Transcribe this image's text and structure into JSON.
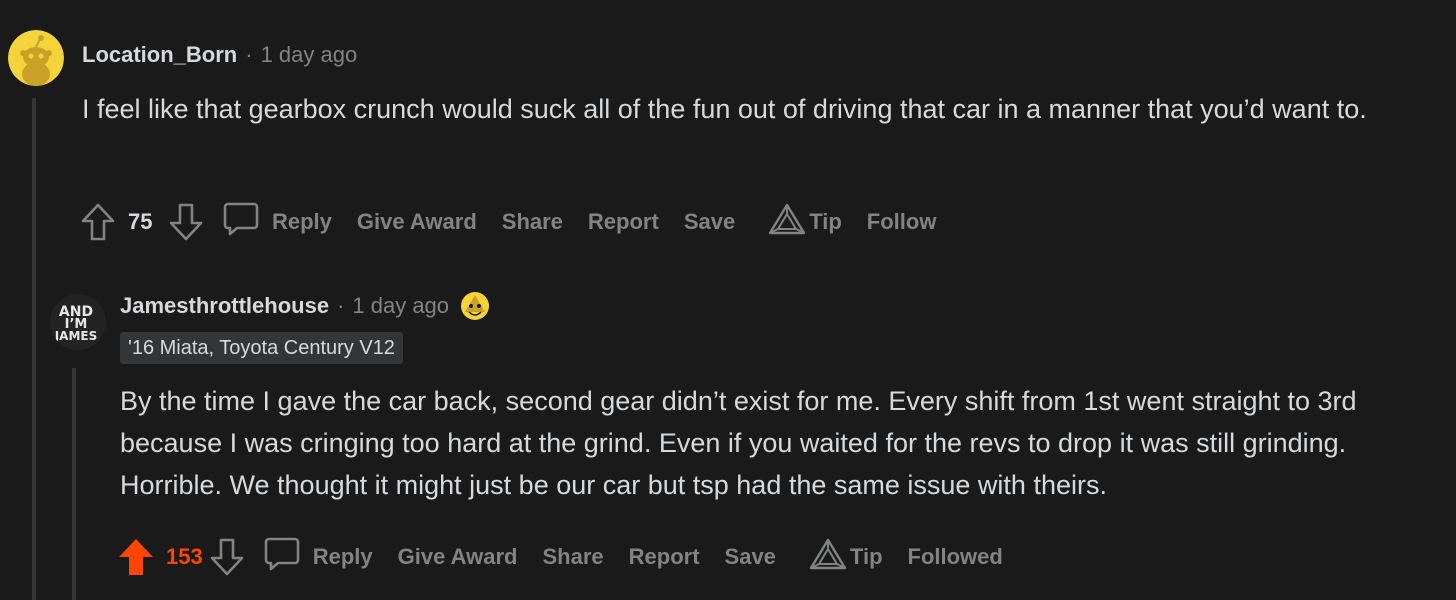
{
  "colors": {
    "background": "#1a1a1b",
    "text": "#d7dadc",
    "muted": "#818384",
    "upvote": "#ff4500",
    "flair_bg": "#343536"
  },
  "comments": [
    {
      "username": "Location_Born",
      "separator": "·",
      "time": "1 day ago",
      "avatar_icon": "snoo-avatar-icon",
      "body": "I feel like that gearbox crunch would suck all of the fun out of driving that car in a manner that you’d want to.",
      "score": "75",
      "upvoted": false,
      "actions": {
        "reply": "Reply",
        "give_award": "Give Award",
        "share": "Share",
        "report": "Report",
        "save": "Save",
        "tip": "Tip",
        "follow": "Follow"
      }
    },
    {
      "username": "Jamesthrottlehouse",
      "separator": "·",
      "time": "1 day ago",
      "avatar_icon": "and-im-james-logo-icon",
      "avatar_text": [
        "AND",
        "I’M",
        "JAMES"
      ],
      "flair": "'16 Miata, Toyota Century V12",
      "body": "By the time I gave the car back, second gear didn’t exist for me. Every shift from 1st went straight to 3rd because I was cringing too hard at the grind. Even if you waited for the revs to drop it was still grinding. Horrible. We thought it might just be our car but tsp had the same issue with theirs.",
      "score": "153",
      "upvoted": true,
      "actions": {
        "reply": "Reply",
        "give_award": "Give Award",
        "share": "Share",
        "report": "Report",
        "save": "Save",
        "tip": "Tip",
        "follow": "Followed"
      }
    }
  ]
}
